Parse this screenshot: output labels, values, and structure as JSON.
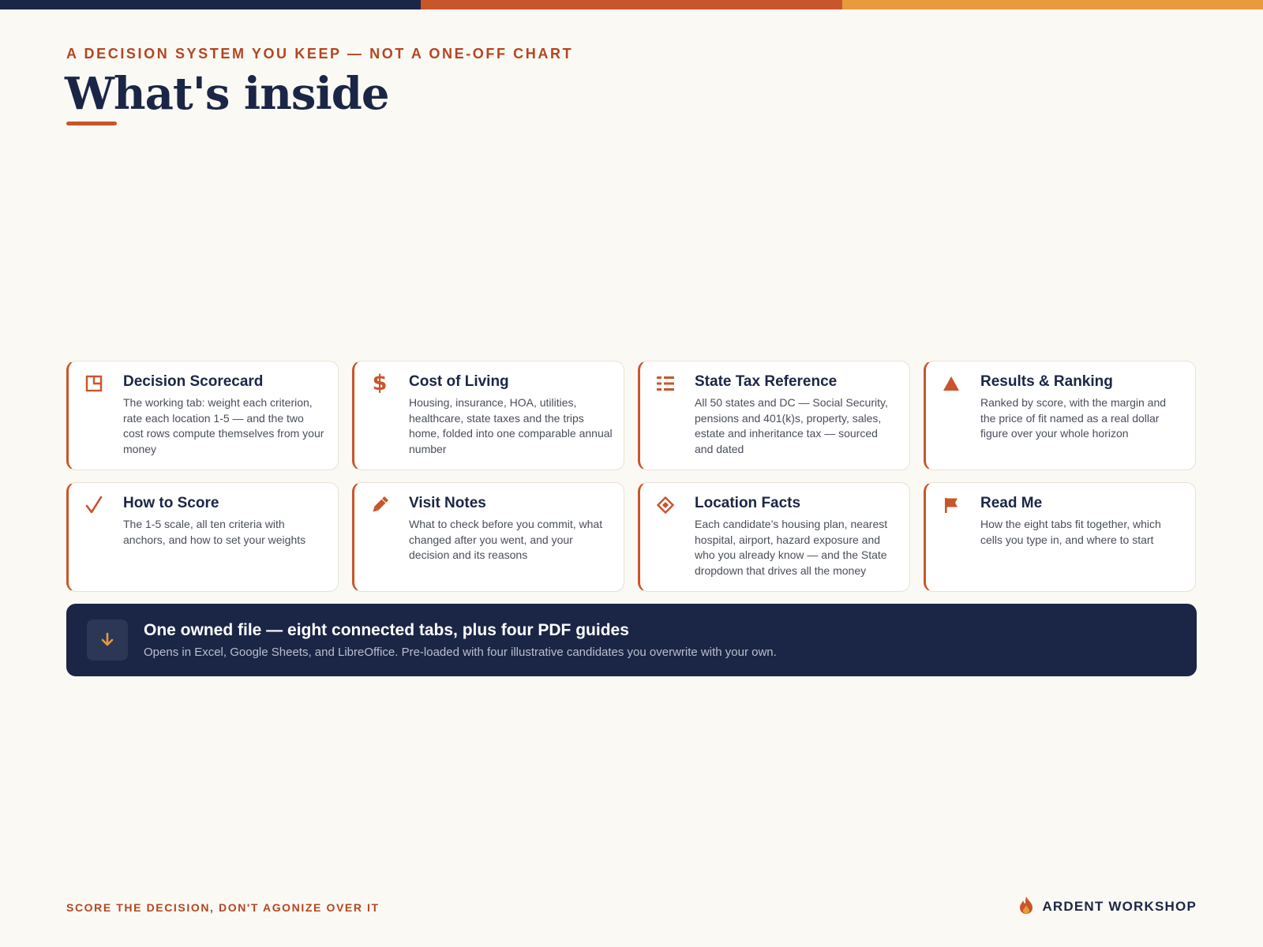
{
  "top_bar": {
    "colors": [
      "#1B2646",
      "#C9552B",
      "#E89A3C"
    ]
  },
  "header": {
    "eyebrow": "A DECISION SYSTEM YOU KEEP — NOT A ONE-OFF CHART",
    "title": "What's inside",
    "accent_color": "#C9552B"
  },
  "cards": [
    {
      "icon": "scorecard-icon",
      "title": "Decision Scorecard",
      "description": "The working tab: weight each criterion, rate each location 1-5 — and the two cost rows compute themselves from your money"
    },
    {
      "icon": "dollar-icon",
      "title": "Cost of Living",
      "description": "Housing, insurance, HOA, utilities, healthcare, state taxes and the trips home, folded into one comparable annual number"
    },
    {
      "icon": "list-icon",
      "title": "State Tax Reference",
      "description": "All 50 states and DC — Social Security, pensions and 401(k)s, property, sales, estate and inheritance tax — sourced and dated"
    },
    {
      "icon": "triangle-icon",
      "title": "Results & Ranking",
      "description": "Ranked by score, with the margin and the price of fit named as a real dollar figure over your whole horizon"
    },
    {
      "icon": "checkmark-icon",
      "title": "How to Score",
      "description": "The 1-5 scale, all ten criteria with anchors, and how to set your weights"
    },
    {
      "icon": "pencil-icon",
      "title": "Visit Notes",
      "description": "What to check before you commit, what changed after you went, and your decision and its reasons"
    },
    {
      "icon": "diamond-icon",
      "title": "Location Facts",
      "description": "Each candidate’s housing plan, nearest hospital, airport, hazard exposure and who you already know — and the State dropdown that drives all the money"
    },
    {
      "icon": "flag-icon",
      "title": "Read Me",
      "description": "How the eight tabs fit together, which cells you type in, and where to start"
    }
  ],
  "banner": {
    "icon": "download-arrow-icon",
    "title": "One owned file — eight connected tabs, plus four PDF guides",
    "subtitle": "Opens in Excel, Google Sheets, and LibreOffice. Pre-loaded with four illustrative candidates you overwrite with your own."
  },
  "footer": {
    "tagline": "SCORE THE DECISION, DON'T AGONIZE OVER IT",
    "brand_icon": "flame-logo-icon",
    "brand": "ARDENT WORKSHOP"
  }
}
